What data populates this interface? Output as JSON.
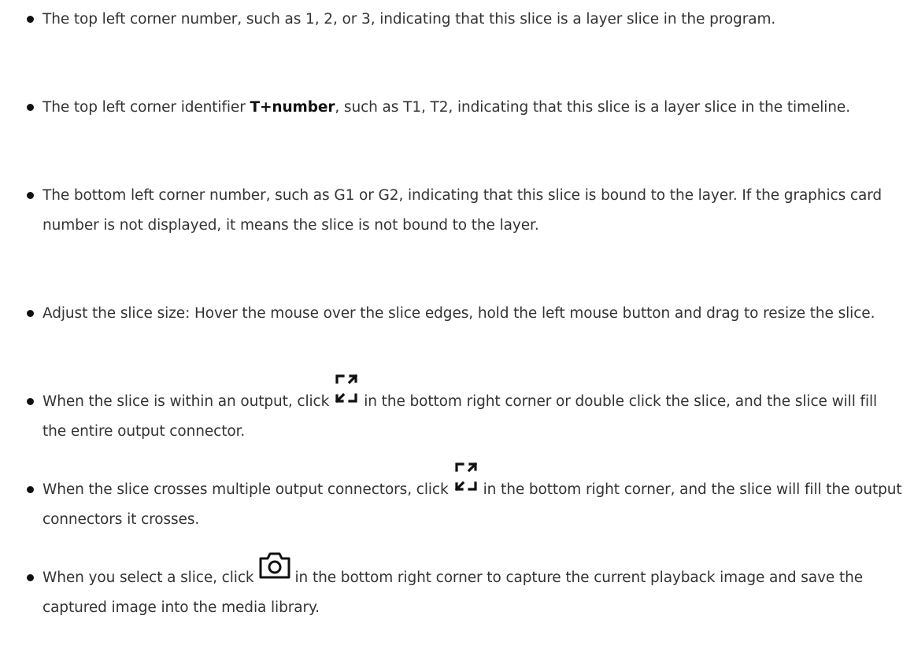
{
  "items": [
    {
      "text": "The top left corner number, such as 1, 2, or 3, indicating that this slice is a layer slice in the program."
    },
    {
      "before": "The top left corner identifier ",
      "bold": "T+number",
      "after": ", such as T1, T2, indicating that this slice is a layer slice in the timeline."
    },
    {
      "text": "The bottom left corner number, such as G1 or G2, indicating that this slice is bound to the layer. If the graphics card number is not displayed, it means the slice is not bound to the layer."
    },
    {
      "text": "Adjust the slice size: Hover the mouse over the slice edges, hold the left mouse button and drag to resize the slice."
    },
    {
      "before": "When the slice is within an output, click",
      "icon": "expand-fill-icon",
      "after": "in the bottom right corner or double click the slice, and the slice will fill the entire output connector."
    },
    {
      "before": "When the slice crosses multiple output connectors, click",
      "icon": "expand-fill-icon",
      "after": "in the bottom right corner, and the slice will fill the output connectors it crosses."
    },
    {
      "before": "When you select a slice, click",
      "icon": "camera-icon",
      "after": "in the bottom right corner to capture the current playback image and save the captured image into the media library."
    }
  ]
}
